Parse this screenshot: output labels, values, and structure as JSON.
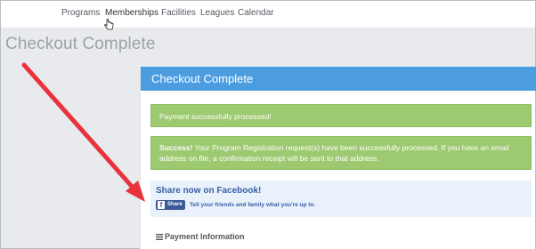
{
  "nav": {
    "items": [
      {
        "label": "Programs"
      },
      {
        "label": "Memberships"
      },
      {
        "label": "Facilities"
      },
      {
        "label": "Leagues"
      },
      {
        "label": "Calendar"
      }
    ]
  },
  "page": {
    "title": "Checkout Complete"
  },
  "panel": {
    "title": "Checkout Complete",
    "alert_payment": "Payment successfully processed!",
    "alert_success_strong": "Success!",
    "alert_success_text": " Your Program Registration request(s) have been successfully processed. If you have an email address on file, a confirmation receipt will be sent to that address.",
    "share_heading": "Share now on Facebook!",
    "share_button": "Share",
    "share_text": "Tell your friends and family what you're up to.",
    "payment_section": "Payment Information"
  },
  "colors": {
    "header_blue": "#4c9de0",
    "alert_green": "#9dc971",
    "share_bg": "#e9f2fb",
    "facebook_blue": "#3b5998",
    "annotation_arrow": "#e8323c"
  },
  "icons": {
    "cursor": "hand-pointer-icon",
    "facebook": "facebook-icon",
    "menu": "menu-icon"
  }
}
